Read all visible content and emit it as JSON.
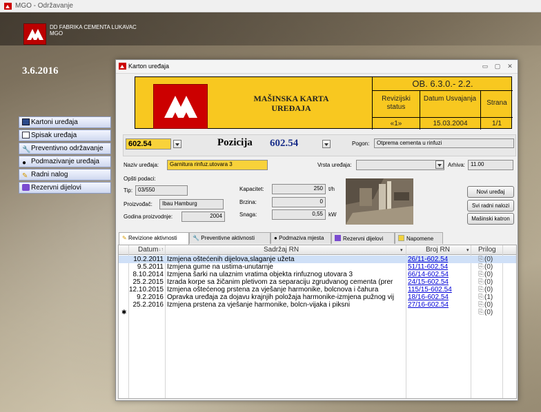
{
  "app": {
    "title": "MGO - Održavanje"
  },
  "company": {
    "line1": "DD FABRIKA CEMENTA LUKAVAC",
    "line2": "MGO"
  },
  "date": "3.6.2016",
  "menu": [
    {
      "label": "Kartoni uređaja",
      "icon": "card-icon"
    },
    {
      "label": "Spisak uređaja",
      "icon": "list-icon"
    },
    {
      "label": "Preventivno održavanje",
      "icon": "wrench-icon"
    },
    {
      "label": "Podmazivanje uređaja",
      "icon": "oil-drop-icon"
    },
    {
      "label": "Radni nalog",
      "icon": "pencil-icon"
    },
    {
      "label": "Rezervni dijelovi",
      "icon": "parts-icon"
    }
  ],
  "window": {
    "title": "Karton uređaja",
    "min": "▭",
    "max": "▢",
    "close": "✕"
  },
  "header": {
    "title1": "MAŠINSKA KARTA",
    "title2": "UREĐAJA",
    "code": "OB. 6.3.0.- 2.2.",
    "col1_h": "Revizijski status",
    "col2_h": "Datum Usvajanja",
    "col3_h": "Strana",
    "col1_v": "«1»",
    "col2_v": "15.03.2004",
    "col3_v": "1/1"
  },
  "filter": {
    "code": "602.54",
    "pozicija_label": "Pozicija",
    "pozicija_value": "602.54",
    "pogon_label": "Pogon:",
    "pogon_value": "Otprema cementa u rinfuzi"
  },
  "device": {
    "naziv_label": "Naziv uređaja:",
    "naziv_value": "Garnitura rinfuz.utovara 3",
    "vrsta_label": "Vrsta uređaja:",
    "vrsta_value": "",
    "arhiva_label": "Arhiva:",
    "arhiva_value": "11.00",
    "opsti_label": "Opšti podaci:",
    "tip_label": "Tip:",
    "tip_value": "03/550",
    "proizvodjac_label": "Proizvođač:",
    "proizvodjac_value": "Ibau Hamburg",
    "godina_label": "Godina proizvodnje:",
    "godina_value": "2004",
    "kapacitet_label": "Kapacitet:",
    "kapacitet_value": "250",
    "kapacitet_unit": "t/h",
    "brzina_label": "Brzina:",
    "brzina_value": "0",
    "snaga_label": "Snaga:",
    "snaga_value": "0,55",
    "snaga_unit": "kW"
  },
  "buttons": {
    "novi": "Novi uređaj",
    "svi": "Svi radni nalozi",
    "masinski": "Mašinski katron"
  },
  "tabs": [
    {
      "label": "Revizione aktivnosti",
      "icon": "pencil-icon"
    },
    {
      "label": "Preventivne aktivnosti",
      "icon": "wrench-icon"
    },
    {
      "label": "Podmaziva mjesta",
      "icon": "oil-drop-icon"
    },
    {
      "label": "Rezervni dijelovi",
      "icon": "parts-icon"
    },
    {
      "label": "Napomene",
      "icon": "note-icon"
    }
  ],
  "table": {
    "headers": {
      "datum": "Datum",
      "sort": "↓↑",
      "sadrzaj": "Sadržaj RN",
      "broj": "Broj RN",
      "prilog": "Prilog"
    },
    "rows": [
      {
        "datum": "10.2.2011",
        "sadrzaj": "Izmjena oštećenih dijelova,slaganje užeta",
        "broj": "26/11-602.54",
        "prilog": "(0)"
      },
      {
        "datum": "9.5.2011",
        "sadrzaj": "Izmjena gume na ustima-unutarnje",
        "broj": "51/11-602.54",
        "prilog": "(0)"
      },
      {
        "datum": "8.10.2014",
        "sadrzaj": "Izmjena šarki na ulaznim vratima objekta rinfuznog utovara 3",
        "broj": "66/14-602.54",
        "prilog": "(0)"
      },
      {
        "datum": "25.2.2015",
        "sadrzaj": "Izrada korpe sa žičanim pletivom za separaciju zgrudvanog cementa (prer",
        "broj": "24/15-602.54",
        "prilog": "(0)"
      },
      {
        "datum": "12.10.2015",
        "sadrzaj": "Izmjena oštećenog prstena za vješanje harmonike, bolcnova i čahura",
        "broj": "115/15-602.54",
        "prilog": "(0)"
      },
      {
        "datum": "9.2.2016",
        "sadrzaj": "Opravka uređaja za dojavu krajnjih položaja harmonike-izmjena pužnog vij",
        "broj": "18/16-602.54",
        "prilog": "(1)"
      },
      {
        "datum": "25.2.2016",
        "sadrzaj": "Izmjena prstena za vješanje harmonike, bolcn-vijaka i piksni",
        "broj": "27/16-602.54",
        "prilog": "(0)"
      }
    ],
    "new_marker": "✱",
    "new_prilog": "(0)"
  },
  "colors": {
    "header_yellow": "#f8c820",
    "logo_red": "#c00000",
    "link": "#0000d8",
    "menu_bg": "#dbe3f5"
  }
}
